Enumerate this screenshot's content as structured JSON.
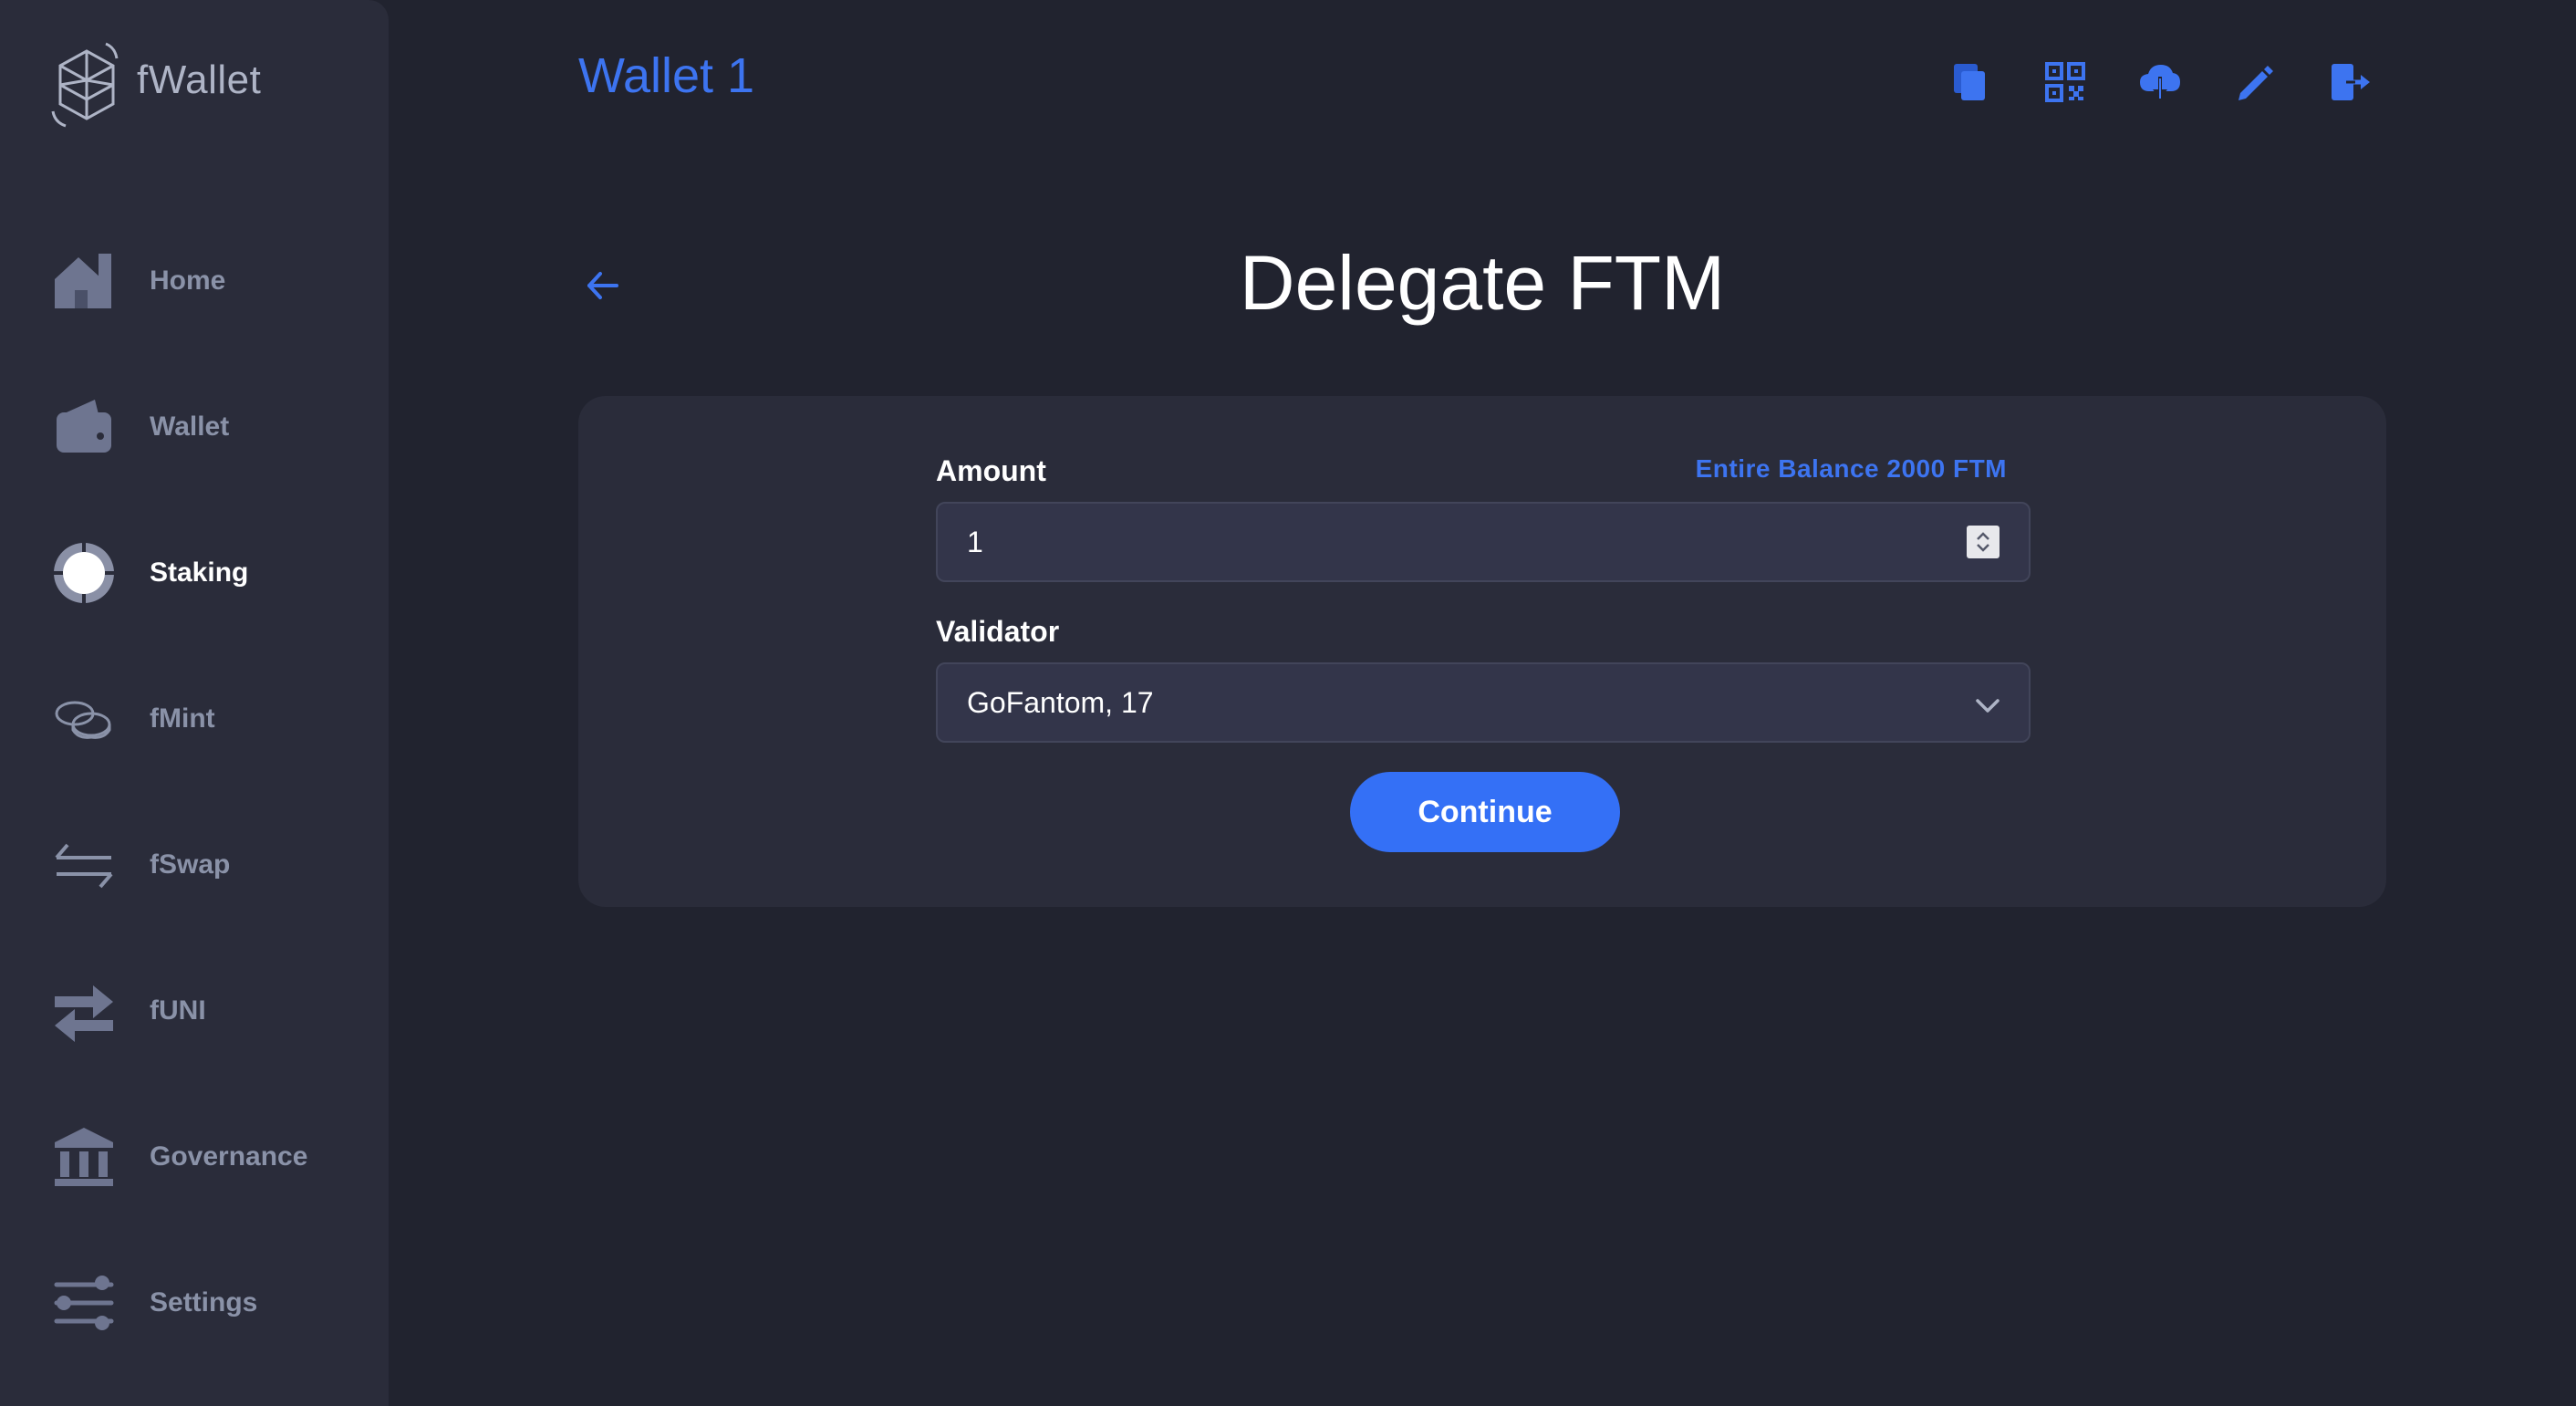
{
  "app": {
    "name": "fWallet"
  },
  "sidebar": {
    "items": [
      {
        "label": "Home",
        "icon": "home-icon",
        "active": false
      },
      {
        "label": "Wallet",
        "icon": "wallet-icon",
        "active": false
      },
      {
        "label": "Staking",
        "icon": "staking-icon",
        "active": true
      },
      {
        "label": "fMint",
        "icon": "coins-icon",
        "active": false
      },
      {
        "label": "fSwap",
        "icon": "swap-icon",
        "active": false
      },
      {
        "label": "fUNI",
        "icon": "transfer-arrows-icon",
        "active": false
      },
      {
        "label": "Governance",
        "icon": "bank-icon",
        "active": false
      },
      {
        "label": "Settings",
        "icon": "sliders-icon",
        "active": false
      }
    ]
  },
  "header": {
    "wallet_title": "Wallet 1",
    "actions": [
      "copy-icon",
      "qr-code-icon",
      "cloud-download-icon",
      "edit-pencil-icon",
      "logout-icon"
    ]
  },
  "page": {
    "title": "Delegate FTM"
  },
  "form": {
    "amount_label": "Amount",
    "entire_balance": "Entire Balance 2000 FTM",
    "amount_value": "1",
    "validator_label": "Validator",
    "validator_value": "GoFantom, 17",
    "continue_label": "Continue"
  },
  "colors": {
    "background": "#21232f",
    "sidebar": "#2a2c3a",
    "accent": "#3d74f0",
    "button": "#3470f6",
    "muted": "#8a92a8"
  }
}
